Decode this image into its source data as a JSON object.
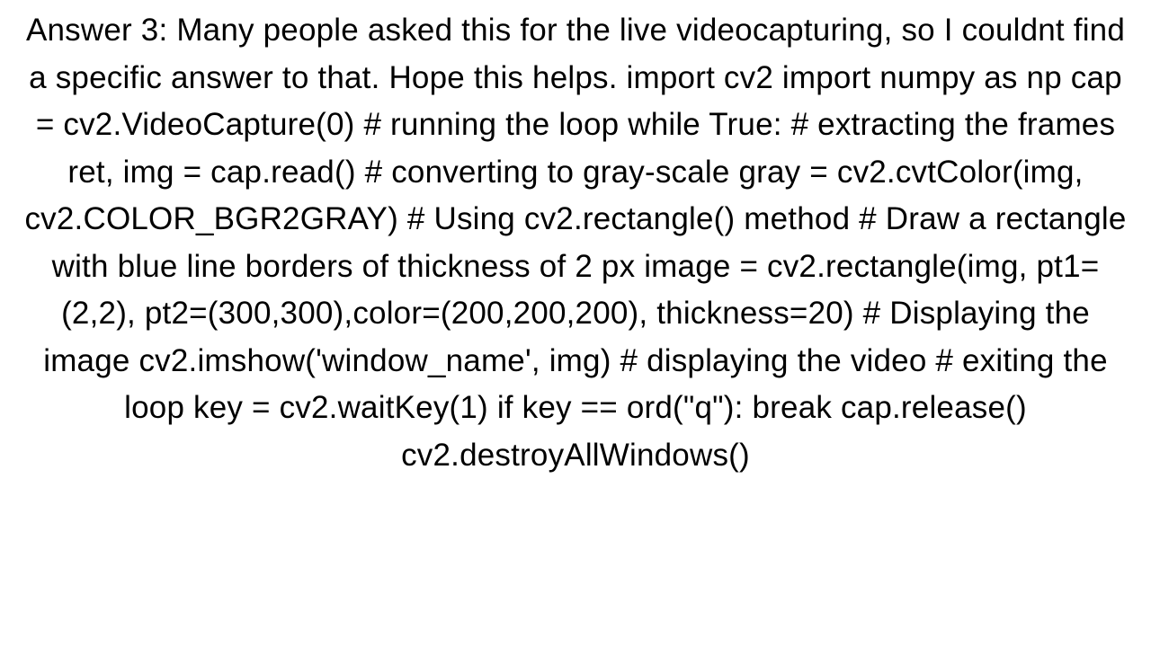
{
  "answer": {
    "text": "Answer 3: Many people asked this for the live videocapturing, so I couldnt find a specific answer to that. Hope this helps. import cv2  import numpy as np  cap = cv2.VideoCapture(0)  # running the loop  while True:       # extracting the frames       ret, img = cap.read()         # converting to gray-scale       gray = cv2.cvtColor(img, cv2.COLOR_BGR2GRAY)       # Using cv2.rectangle() method     # Draw a rectangle with blue line borders of thickness of 2 px       image = cv2.rectangle(img, pt1=(2,2), pt2=(300,300),color=(200,200,200), thickness=20)       # Displaying the image       cv2.imshow('window_name', img)         # displaying the video       # exiting the loop       key = cv2.waitKey(1)       if key == ord(\"q\"):           break  cap.release() cv2.destroyAllWindows()"
  }
}
